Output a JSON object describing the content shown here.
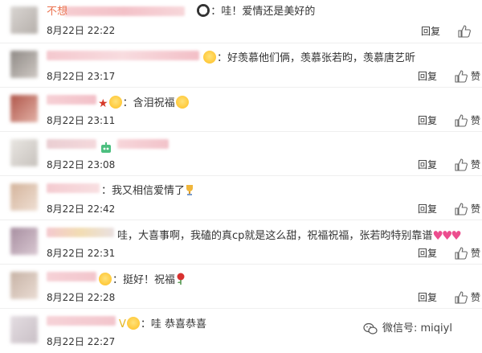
{
  "comments": [
    {
      "name": "不想",
      "text": "哇！爱情还是美好的",
      "time": "8月22日 22:22",
      "reply": "回复",
      "like": "赞"
    },
    {
      "name": "",
      "text": "好羡慕他们俩，羡慕张若昀，羡慕唐艺昕",
      "time": "8月22日 23:17",
      "reply": "回复",
      "like": "赞"
    },
    {
      "name": "",
      "text": "含泪祝福",
      "time": "8月22日 23:11",
      "reply": "回复",
      "like": "赞"
    },
    {
      "name": "",
      "text": "",
      "time": "8月22日 23:08",
      "reply": "回复",
      "like": "赞"
    },
    {
      "name": "",
      "text": "我又相信爱情了",
      "time": "8月22日 22:42",
      "reply": "回复",
      "like": "赞"
    },
    {
      "name": "",
      "text": "哇，大喜事啊，我磕的真cp就是这么甜，祝福祝福，张若昀特别靠谱",
      "time": "8月22日 22:31",
      "reply": "回复",
      "like": "赞"
    },
    {
      "name": "",
      "text": "挺好！祝福",
      "time": "8月22日 22:28",
      "reply": "回复",
      "like": "赞"
    },
    {
      "name": "",
      "text": "哇 恭喜恭喜",
      "time": "8月22日 22:27",
      "reply": "",
      "like": ""
    }
  ],
  "watermark": {
    "label": "微信号: miqiyl",
    "icon": "wechat-icon"
  },
  "colors": {
    "name": "#eb7350",
    "text": "#333333",
    "divider": "#efefef"
  }
}
